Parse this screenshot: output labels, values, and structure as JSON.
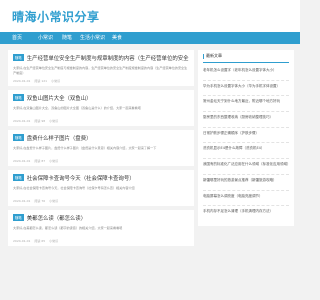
{
  "site": {
    "title": "晴海小常识分享"
  },
  "nav": [
    "首页",
    "小常识",
    "随笔",
    "生活小常识",
    "美食"
  ],
  "posts": [
    {
      "category": "随笔",
      "title": "生产经营单位安全生产制度与规章制度的内容（生产经营单位的安全",
      "excerpt": "大家好,在生产经营单位安全生产制度与规章制度的内容，生产经营单位的安全生产制度规章制度的内容（生产经营单位的安全生产制度）",
      "meta": [
        "2024-01-01",
        "阅读 121",
        "小常识"
      ]
    },
    {
      "category": "随笔",
      "title": "双鱼山图片大全（双鱼山）",
      "excerpt": "大家好,在双鱼山图片大全，双鱼山的图片大全图（双鱼山是什么）的介绍，大家一起来看看吧",
      "meta": [
        "2024-01-01",
        "阅读 98",
        "小常识"
      ]
    },
    {
      "category": "随笔",
      "title": "盘费什么样子图片（盘费）",
      "excerpt": "大家好,在盘费什么样子图片，盘费什么样子图片（盘费是什么意思）相关内容介绍，大家一起来了解一下",
      "meta": [
        "2024-01-01",
        "阅读 87",
        "小常识"
      ]
    },
    {
      "category": "随笔",
      "title": "社会保障卡查询号今天（社会保障卡查询号）",
      "excerpt": "大家好,在社会保障卡查询号今天，社会保障卡查询号（社保卡号码怎么查）相关内容介绍",
      "meta": [
        "2024-01-01",
        "阅读 76",
        "小常识"
      ]
    },
    {
      "category": "随笔",
      "title": "美都怎么读（都怎么读）",
      "excerpt": "大家好,在美都怎么读，都怎么读（都字的读音）的相关介绍，大家一起来看看吧",
      "meta": [
        "2024-01-01",
        "阅读 65",
        "小常识"
      ]
    }
  ],
  "sidebar": {
    "heading": "最新文章",
    "items": [
      "老年机怎么设置字（老年机怎么设置字体大小）",
      "华为手机怎么设置字体大小（华为手机字体设置）",
      "常州金坛天宁到什么地方最近，附近哪个地方好玩",
      "厨房里的东西整理收纳（厨房收纳整理技巧）",
      "日常护肤步骤正确顺序（护肤步骤）",
      "洗衣机显示E4是什么故障（洗衣机E4）",
      "我国有的标准化广泛应用在什么领域（标准化应用领域）",
      "新疆哪里好玩的旅游景点推荐（新疆旅游攻略）",
      "电脑屏幕怎么调亮度（电脑亮度调节）",
      "手机内存不足怎么清理（手机清理内存方法）"
    ]
  }
}
